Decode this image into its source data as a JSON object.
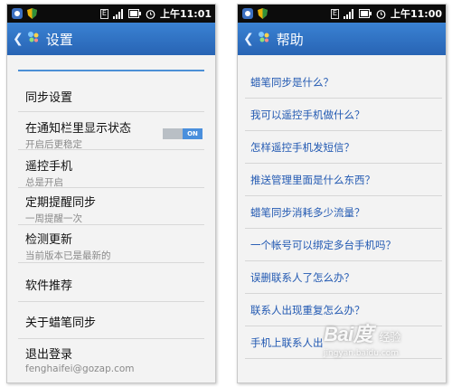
{
  "status_bar": {
    "network": "E",
    "time": "上午11:01",
    "time_right": "上午11:00"
  },
  "settings": {
    "title": "设置",
    "items": [
      {
        "title": "同步设置",
        "subtitle": ""
      },
      {
        "title": "在通知栏里显示状态",
        "subtitle": "开启后更稳定",
        "toggle": "ON"
      },
      {
        "title": "遥控手机",
        "subtitle": "总是开启"
      },
      {
        "title": "定期提醒同步",
        "subtitle": "一周提醒一次"
      },
      {
        "title": "检测更新",
        "subtitle": "当前版本已是最新的"
      },
      {
        "title": "软件推荐",
        "subtitle": ""
      },
      {
        "title": "关于蜡笔同步",
        "subtitle": ""
      },
      {
        "title": "退出登录",
        "subtitle": "fenghaifei@gozap.com"
      }
    ]
  },
  "help": {
    "title": "帮助",
    "items": [
      "蜡笔同步是什么？",
      "我可以遥控手机做什么？",
      "怎样遥控手机发短信？",
      "推送管理里面是什么东西？",
      "蜡笔同步消耗多少流量？",
      "一个帐号可以绑定多台手机吗？",
      "误删联系人了怎么办？",
      "联系人出现重复怎么办？",
      "手机上联系人出"
    ]
  },
  "watermark": {
    "logo": "Bai度",
    "sub": "经验",
    "url": "jingyan.baidu.com"
  },
  "colors": {
    "titlebar": "#2f73c4",
    "accent_line": "#4b8fd6",
    "help_link": "#2259b2",
    "toggle_on": "#4a8fdc"
  }
}
